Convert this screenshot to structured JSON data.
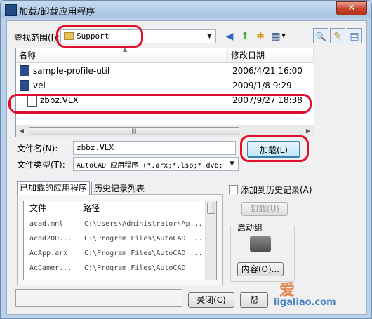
{
  "window": {
    "title": "加载/卸载应用程序",
    "app_icon": "AutoCAD",
    "close_glyph": "✕"
  },
  "lookin": {
    "label": "查找范围(I):",
    "value": "Support",
    "dropdown_glyph": "▼"
  },
  "toolbar": {
    "back_glyph": "◀",
    "up_glyph": "↑",
    "newfolder_glyph": "✱",
    "views_glyph": "▦",
    "views_arrow": "▾",
    "find_glyph": "🔍",
    "tools_glyph": "✎",
    "favorites_glyph": "▤"
  },
  "file_list": {
    "columns": [
      "名称",
      "修改日期"
    ],
    "sort_glyph": "▲",
    "rows": [
      {
        "name": "sample-profile-util",
        "date": "2006/4/21 16:00",
        "icon": "vlx-file-icon"
      },
      {
        "name": "vel",
        "date": "2009/1/8 9:29",
        "icon": "vlx-file-icon"
      },
      {
        "name": "zbbz.VLX",
        "date": "2007/9/27 18:38",
        "icon": "blank-file-icon"
      }
    ],
    "scroll_left": "◀",
    "scroll_right": "▶",
    "thumb_grip": "|||"
  },
  "filename": {
    "label": "文件名(N):",
    "value": "zbbz.VLX"
  },
  "filetype": {
    "label": "文件类型(T):",
    "value": "AutoCAD 应用程序 (*.arx;*.lsp;*.dvb;",
    "dropdown_glyph": "▼"
  },
  "load_button": "加载(L)",
  "tabs": {
    "loaded": "已加载的应用程序",
    "history": "历史记录列表"
  },
  "loaded_list": {
    "columns": [
      "文件",
      "路径"
    ],
    "rows": [
      {
        "file": "acad.mnl",
        "path": "C:\\Users\\Administrator\\Ap..."
      },
      {
        "file": "acad200...",
        "path": "C:\\Program Files\\AutoCAD ..."
      },
      {
        "file": "AcApp.arx",
        "path": "C:\\Program Files\\AutoCAD ..."
      },
      {
        "file": "AcCamer...",
        "path": "C:\\Program Files\\AutoCAD"
      }
    ]
  },
  "add_history": {
    "label": "添加到历史记录(A)",
    "checked": false
  },
  "unload_button": "卸载(U)",
  "startup": {
    "label": "启动组",
    "contents_button": "内容(O)..."
  },
  "close_button": "关闭(C)",
  "help_button": "帮",
  "watermark": {
    "line1": "爱",
    "line2": "iigaliao.com"
  }
}
